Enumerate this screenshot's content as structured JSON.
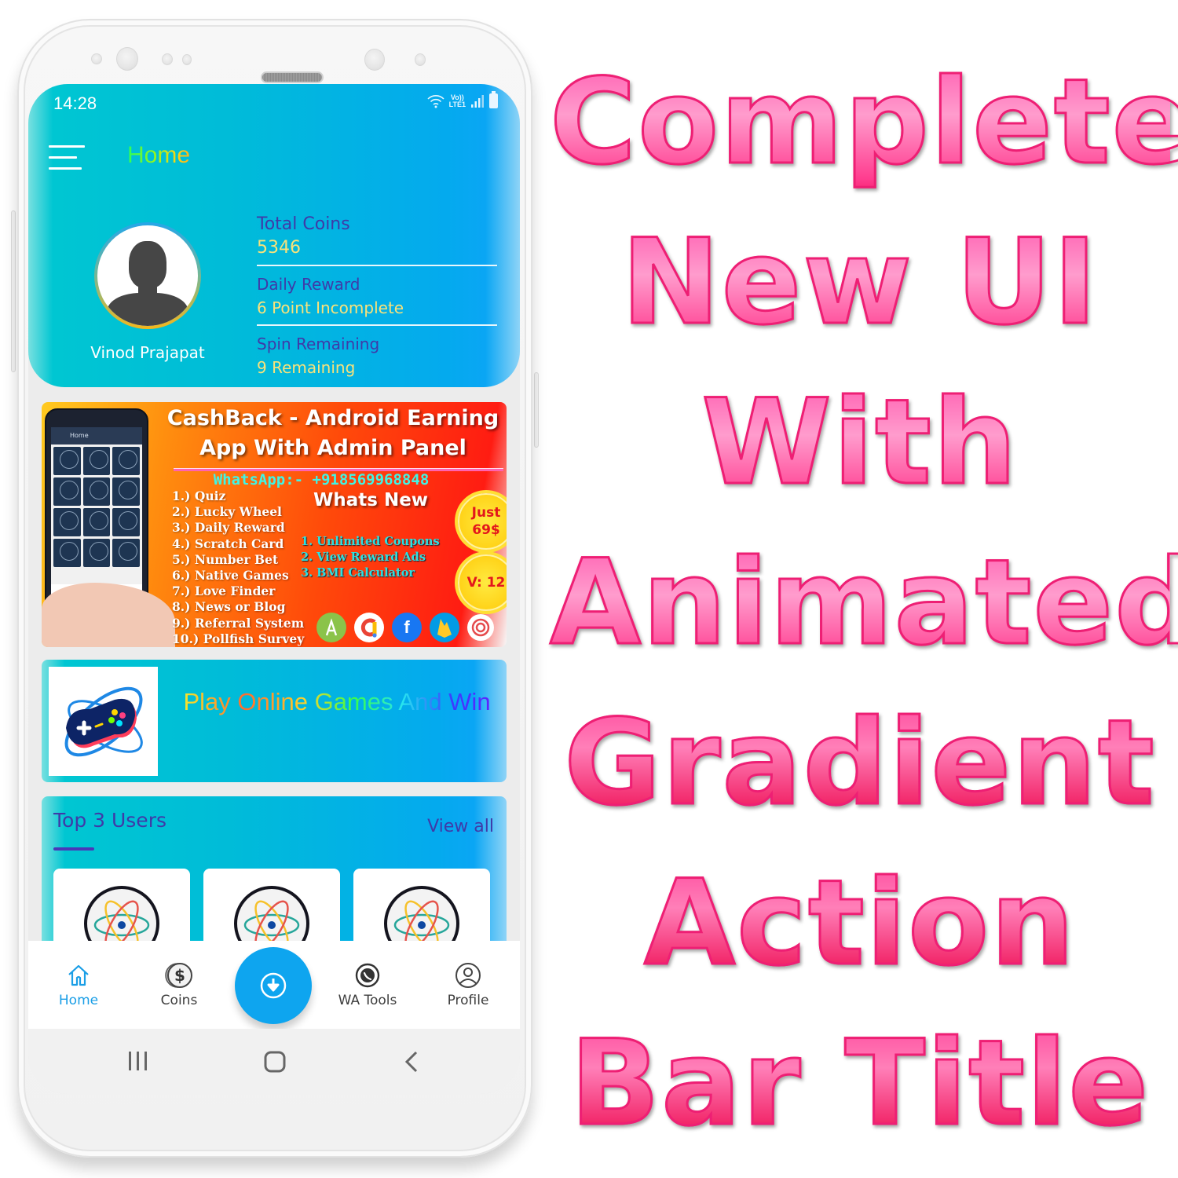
{
  "status_bar": {
    "time": "14:28",
    "network_label_top": "Vo))",
    "network_label_bottom": "LTE1",
    "icons": [
      "wifi-icon",
      "signal-icon",
      "battery-icon"
    ]
  },
  "action_bar": {
    "menu_icon": "hamburger-menu-icon",
    "title": "Home",
    "title_gradient": [
      "#2bff5a",
      "#9cf519",
      "#ffd414",
      "#ffb01a"
    ]
  },
  "profile": {
    "name": "Vinod Prajapat",
    "avatar_icon": "user-silhouette-icon",
    "stats": [
      {
        "label": "Total Coins",
        "value": "5346"
      },
      {
        "label": "Daily Reward",
        "value": "6 Point Incomplete"
      },
      {
        "label": "Spin Remaining",
        "value": "9 Remaining"
      }
    ]
  },
  "promo_banner": {
    "title_line1": "CashBack - Android Earning",
    "title_line2": "App With Admin Panel",
    "whatsapp": "WhatsApp:- +918569968848",
    "features": [
      "1.) Quiz",
      "2.) Lucky Wheel",
      "3.) Daily Reward",
      "4.) Scratch Card",
      "5.) Number Bet",
      "6.) Native Games",
      "7.) Love Finder",
      "8.) News or Blog",
      "9.) Referral System",
      "10.) Pollfish Survey"
    ],
    "whats_new_heading": "Whats New",
    "whats_new": [
      "1.  Unlimited Coupons",
      "2.  View Reward Ads",
      "3.  BMI Calculator"
    ],
    "price_badge_line1": "Just",
    "price_badge_line2": "69$",
    "version_badge": "V: 12",
    "mini_app_title": "Home",
    "tech_logos": [
      "android-studio-icon",
      "admob-icon",
      "facebook-icon",
      "firebase-icon",
      "onesignal-icon"
    ]
  },
  "games_card": {
    "text": "Play Online Games And Win",
    "thumb_icon": "gamepad-icon"
  },
  "top_users": {
    "title": "Top 3 Users",
    "view_all": "View all",
    "users": [
      {
        "avatar_icon": "atom-icon"
      },
      {
        "avatar_icon": "atom-icon"
      },
      {
        "avatar_icon": "atom-icon"
      }
    ]
  },
  "bottom_nav": {
    "items": [
      {
        "label": "Home",
        "icon": "home-icon",
        "active": true
      },
      {
        "label": "Coins",
        "icon": "coin-dollar-icon",
        "active": false
      },
      {
        "label": "WA Tools",
        "icon": "whatsapp-icon",
        "active": false
      },
      {
        "label": "Profile",
        "icon": "profile-icon",
        "active": false
      }
    ],
    "fab_icon": "download-icon"
  },
  "system_nav": [
    "recents-icon",
    "home-circle-icon",
    "back-icon"
  ],
  "headline": {
    "lines": [
      "Complete",
      "New UI",
      "With",
      "Animated",
      "Gradient",
      "Action",
      "Bar Title"
    ]
  },
  "colors": {
    "header_gradient": [
      "#00c6d2",
      "#04aaee"
    ],
    "stat_label": "#3f3aa8",
    "stat_value": "#f9e27a",
    "accent": "#0ea5ef",
    "headline_pink": "#ee1f74"
  }
}
